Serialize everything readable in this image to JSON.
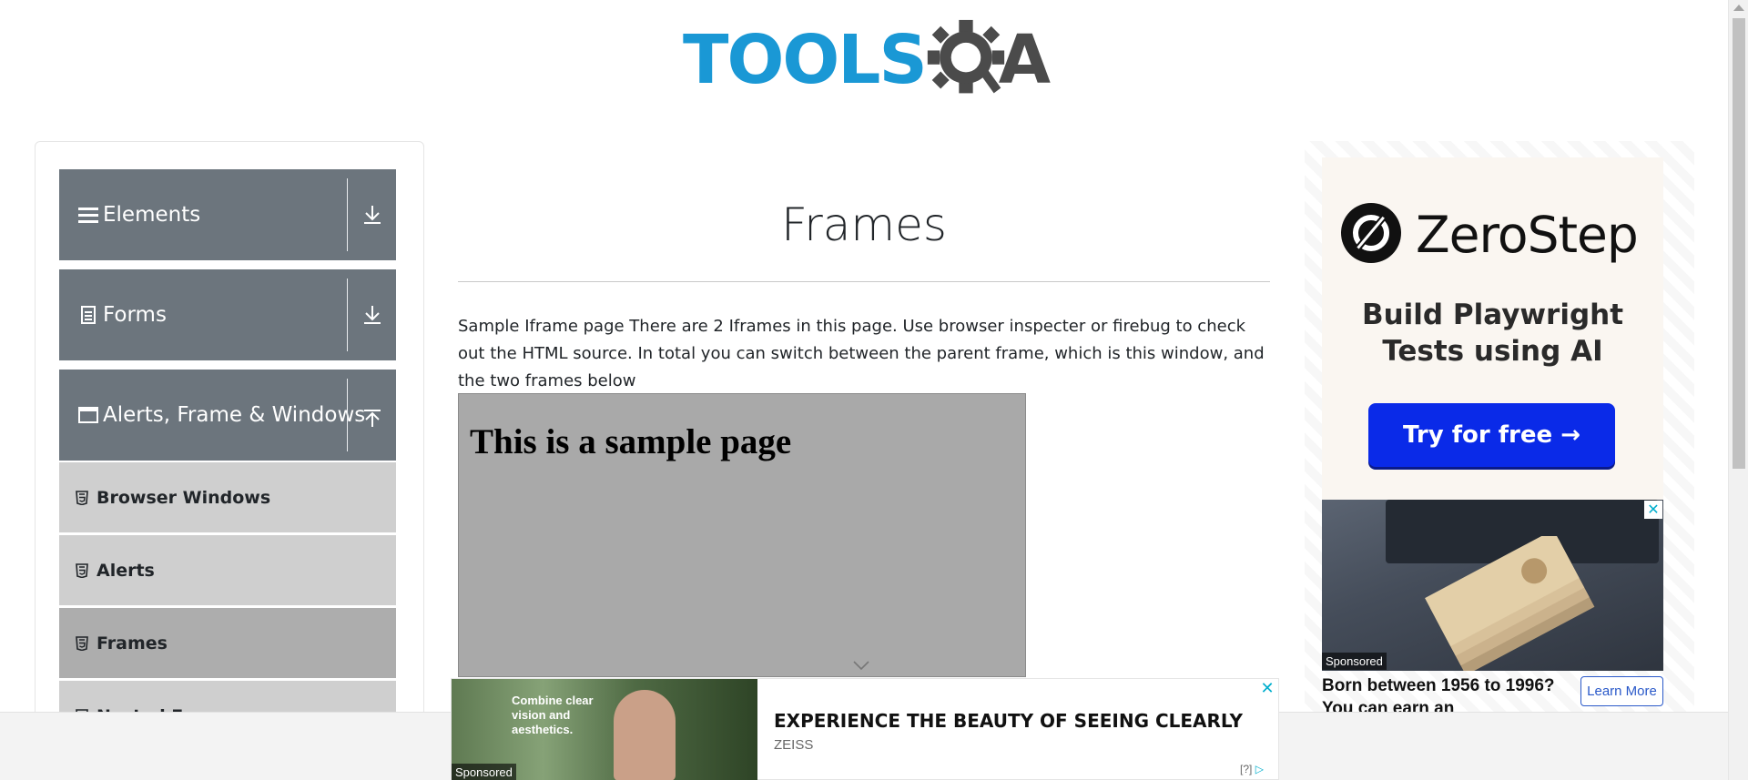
{
  "header": {
    "logo_tools": "TOOLS",
    "logo_a": "A"
  },
  "sidebar": {
    "groups": [
      {
        "label": "Elements",
        "icon": "hamburger-icon",
        "state": "collapsed"
      },
      {
        "label": "Forms",
        "icon": "document-icon",
        "state": "collapsed"
      },
      {
        "label": "Alerts, Frame & Windows",
        "icon": "window-icon",
        "state": "expanded"
      }
    ],
    "items": [
      {
        "label": "Browser Windows",
        "icon": "html5-icon",
        "active": false
      },
      {
        "label": "Alerts",
        "icon": "html5-icon",
        "active": false
      },
      {
        "label": "Frames",
        "icon": "html5-icon",
        "active": true
      },
      {
        "label": "Nested Frames",
        "icon": "html5-icon",
        "active": false
      }
    ]
  },
  "main": {
    "title": "Frames",
    "description": "Sample Iframe page There are 2 Iframes in this page. Use browser inspecter or firebug to check out the HTML source. In total you can switch between the parent frame, which is this window, and the two frames below",
    "iframe_heading": "This is a sample page"
  },
  "right_ad": {
    "brand": "ZeroStep",
    "tagline": "Build Playwright Tests using AI",
    "cta": "Try for free →",
    "sponsored": "Sponsored",
    "headline": "Born between 1956 to 1996? You can earn an",
    "learn_more": "Learn More",
    "close": "✕"
  },
  "bottom_ad": {
    "image_text": "Combine clear vision and aesthetics.",
    "sponsored": "Sponsored",
    "headline": "EXPERIENCE THE BEAUTY OF SEEING CLEARLY",
    "brand": "ZEISS",
    "adchoices": "[?]",
    "close": "✕"
  },
  "colors": {
    "logo_blue": "#1a98d5",
    "logo_gray": "#4b4b4b",
    "group_bg": "#6c757d",
    "item_bg": "#cfcfcf",
    "item_active_bg": "#adadad",
    "cta_blue": "#0a2ae8"
  }
}
